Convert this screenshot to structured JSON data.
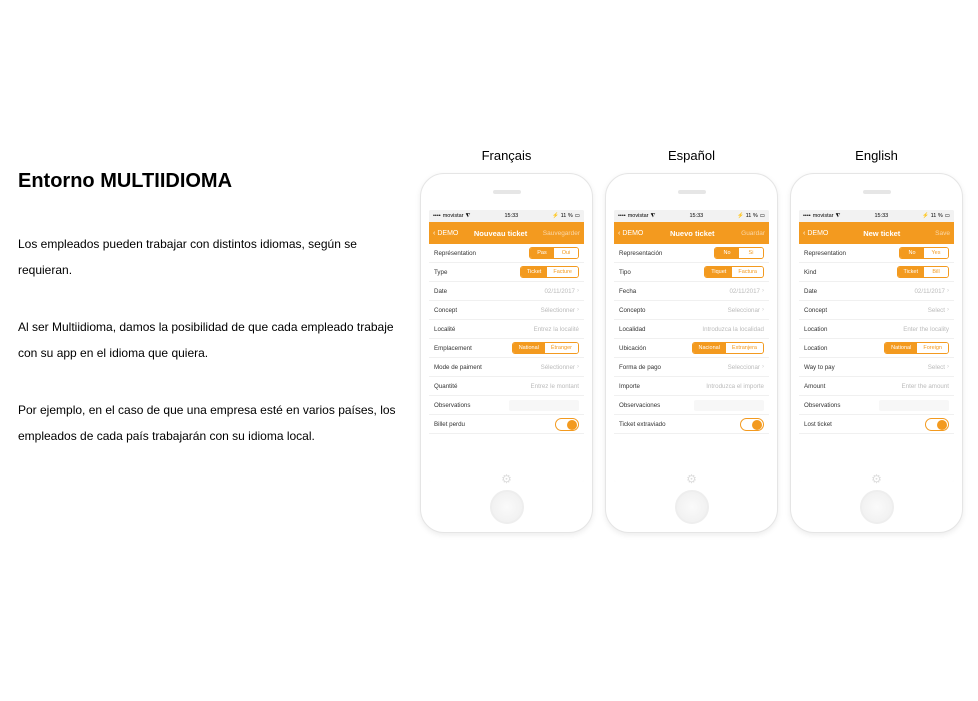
{
  "text": {
    "title": "Entorno MULTIIDIOMA",
    "p1": "Los empleados pueden trabajar con distintos idiomas, según se requieran.",
    "p2": "Al ser Multiidioma, damos la posibilidad de que cada empleado trabaje con su app en el idioma que quiera.",
    "p3": "Por ejemplo, en el caso de que una empresa esté en varios países,  los empleados de cada país trabajarán con su idioma local."
  },
  "status": {
    "carrier": "movistar",
    "time": "15:33",
    "battery": "11 %"
  },
  "phones": [
    {
      "lang": "Français",
      "nav": {
        "back": "DEMO",
        "title": "Nouveau ticket",
        "save": "Sauvegarder"
      },
      "rows": [
        {
          "label": "Représentation",
          "type": "segment",
          "opts": [
            "Pas",
            "Oui"
          ],
          "active": 0
        },
        {
          "label": "Type",
          "type": "segment",
          "opts": [
            "Ticket",
            "Facture"
          ],
          "active": 0
        },
        {
          "label": "Date",
          "type": "value",
          "value": "02/11/2017"
        },
        {
          "label": "Concept",
          "type": "link",
          "value": "Sélectionner"
        },
        {
          "label": "Localité",
          "type": "placeholder",
          "value": "Entrez la localité"
        },
        {
          "label": "Emplacement",
          "type": "segment",
          "opts": [
            "National",
            "Étranger"
          ],
          "active": 0
        },
        {
          "label": "Mode de paiment",
          "type": "link",
          "value": "Sélectionner"
        },
        {
          "label": "Quantité",
          "type": "placeholder",
          "value": "Entrez le montant"
        },
        {
          "label": "Observations",
          "type": "input"
        },
        {
          "label": "Billet perdu",
          "type": "toggle"
        }
      ]
    },
    {
      "lang": "Español",
      "nav": {
        "back": "DEMO",
        "title": "Nuevo ticket",
        "save": "Guardar"
      },
      "rows": [
        {
          "label": "Representación",
          "type": "segment",
          "opts": [
            "No",
            "Si"
          ],
          "active": 0
        },
        {
          "label": "Tipo",
          "type": "segment",
          "opts": [
            "Tiquet",
            "Factura"
          ],
          "active": 0
        },
        {
          "label": "Fecha",
          "type": "value",
          "value": "02/11/2017"
        },
        {
          "label": "Concepto",
          "type": "link",
          "value": "Seleccionar"
        },
        {
          "label": "Localidad",
          "type": "placeholder",
          "value": "Introduzca la localidad"
        },
        {
          "label": "Ubicación",
          "type": "segment",
          "opts": [
            "Nacional",
            "Extranjera"
          ],
          "active": 0
        },
        {
          "label": "Forma de pago",
          "type": "link",
          "value": "Seleccionar"
        },
        {
          "label": "Importe",
          "type": "placeholder",
          "value": "Introduzca el importe"
        },
        {
          "label": "Observaciones",
          "type": "input"
        },
        {
          "label": "Ticket extraviado",
          "type": "toggle"
        }
      ]
    },
    {
      "lang": "English",
      "nav": {
        "back": "DEMO",
        "title": "New ticket",
        "save": "Save"
      },
      "rows": [
        {
          "label": "Representation",
          "type": "segment",
          "opts": [
            "No",
            "Yes"
          ],
          "active": 0
        },
        {
          "label": "Kind",
          "type": "segment",
          "opts": [
            "Ticket",
            "Bill"
          ],
          "active": 0
        },
        {
          "label": "Date",
          "type": "value",
          "value": "02/11/2017"
        },
        {
          "label": "Concept",
          "type": "link",
          "value": "Select"
        },
        {
          "label": "Location",
          "type": "placeholder",
          "value": "Enter the locality"
        },
        {
          "label": "Location",
          "type": "segment",
          "opts": [
            "National",
            "Foreign"
          ],
          "active": 0
        },
        {
          "label": "Way to pay",
          "type": "link",
          "value": "Select"
        },
        {
          "label": "Amount",
          "type": "placeholder",
          "value": "Enter the amount"
        },
        {
          "label": "Observations",
          "type": "input"
        },
        {
          "label": "Lost ticket",
          "type": "toggle"
        }
      ]
    }
  ]
}
